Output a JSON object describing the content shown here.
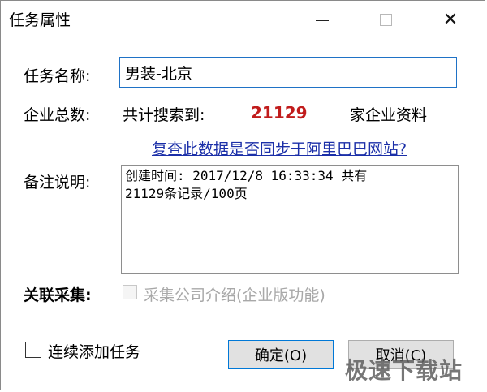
{
  "window": {
    "title": "任务属性",
    "minimize_icon": "minimize-icon",
    "maximize_icon": "maximize-icon",
    "close_icon": "close-icon",
    "close_glyph": "✕"
  },
  "task_name": {
    "label": "任务名称:",
    "value": "男装-北京"
  },
  "company_total": {
    "label": "企业总数:",
    "found_label": "共计搜索到:",
    "count": "21129",
    "suffix": "家企业资料",
    "count_color": "#c11c1c"
  },
  "check_link": {
    "text": "复查此数据是否同步于阿里巴巴网站?"
  },
  "remark": {
    "label": "备注说明:",
    "value": "创建时间: 2017/12/8 16:33:34 共有\n21129条记录/100页"
  },
  "association": {
    "label": "关联采集:",
    "option": "采集公司介绍(企业版功能)",
    "checked": false,
    "enabled": false
  },
  "footer": {
    "continue_label": "连续添加任务",
    "continue_checked": false,
    "ok_label": "确定(O)",
    "cancel_label": "取消(C)"
  },
  "watermark": {
    "text": "极速下载站"
  }
}
